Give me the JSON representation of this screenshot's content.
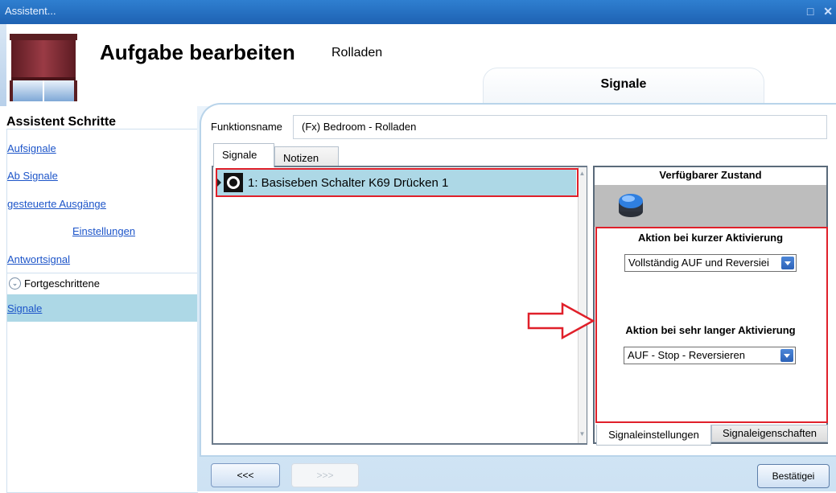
{
  "window": {
    "title": "Assistent...",
    "controls": "□ ✕"
  },
  "header": {
    "title": "Aufgabe bearbeiten",
    "subtitle": "Rolladen",
    "step_tab": "Signale"
  },
  "sidebar": {
    "heading": "Assistent Schritte",
    "links": [
      "Aufsignale",
      "Ab Signale",
      "gesteuerte Ausgänge",
      "Einstellungen",
      "Antwortsignal"
    ],
    "advanced_label": "Fortgeschrittene",
    "active_item": "Signale"
  },
  "form": {
    "function_name_label": "Funktionsname",
    "function_name_value": "(Fx) Bedroom - Rolladen"
  },
  "tabs": [
    "Signale",
    "Notizen"
  ],
  "signal_list": [
    {
      "label": "1: Basiseben Schalter K69 Drücken 1"
    }
  ],
  "right_panel": {
    "available_state_title": "Verfügbarer Zustand",
    "short_activation_title": "Aktion bei kurzer Aktivierung",
    "short_activation_value": "Vollständig AUF und Reversiei",
    "long_activation_title": "Aktion bei sehr langer Aktivierung",
    "long_activation_value": "AUF - Stop - Reversieren",
    "tabs": [
      "Signaleinstellungen",
      "Signaleigenschaften"
    ]
  },
  "buttons": {
    "back": "<<<",
    "next": ">>>",
    "confirm": "Bestätigei"
  },
  "colors": {
    "accent": "#1e62b3",
    "selection": "#add8e6",
    "annotation": "#e0202a"
  }
}
